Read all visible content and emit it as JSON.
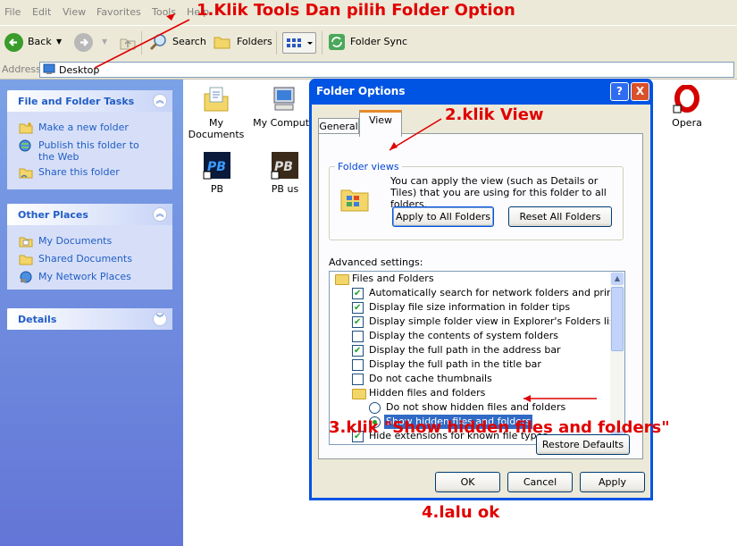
{
  "menu": [
    "File",
    "Edit",
    "View",
    "Favorites",
    "Tools",
    "Help"
  ],
  "toolbar": {
    "back": "Back",
    "search": "Search",
    "folders": "Folders",
    "folder_sync": "Folder Sync"
  },
  "address": {
    "label": "Address",
    "value": "Desktop"
  },
  "tasks_panel": {
    "title": "File and Folder Tasks",
    "links": [
      "Make a new folder",
      "Publish this folder to the Web",
      "Share this folder"
    ]
  },
  "places_panel": {
    "title": "Other Places",
    "links": [
      "My Documents",
      "Shared Documents",
      "My Network Places"
    ]
  },
  "details_panel": {
    "title": "Details"
  },
  "desktop_icons": [
    "My Documents",
    "My Compute",
    "PB",
    "PB us",
    "Opera"
  ],
  "dialog": {
    "title": "Folder Options",
    "help_btn": "?",
    "close_btn": "X",
    "tabs": [
      "General",
      "View"
    ],
    "folder_views": {
      "title": "Folder views",
      "text": "You can apply the view (such as Details or Tiles) that you are using for this folder to all folders.",
      "apply_btn": "Apply to All Folders",
      "reset_btn": "Reset All Folders"
    },
    "advanced_label": "Advanced settings:",
    "tree": [
      {
        "kind": "folder",
        "label": "Files and Folders"
      },
      {
        "kind": "check",
        "label": "Automatically search for network folders and printers",
        "checked": true
      },
      {
        "kind": "check",
        "label": "Display file size information in folder tips",
        "checked": true
      },
      {
        "kind": "check",
        "label": "Display simple folder view in Explorer's Folders list",
        "checked": true
      },
      {
        "kind": "check",
        "label": "Display the contents of system folders",
        "checked": false
      },
      {
        "kind": "check",
        "label": "Display the full path in the address bar",
        "checked": true
      },
      {
        "kind": "check",
        "label": "Display the full path in the title bar",
        "checked": false
      },
      {
        "kind": "check",
        "label": "Do not cache thumbnails",
        "checked": false
      },
      {
        "kind": "folder",
        "label": "Hidden files and folders"
      },
      {
        "kind": "radio",
        "label": "Do not show hidden files and folders",
        "checked": false
      },
      {
        "kind": "radio",
        "label": "Show hidden files and folders",
        "checked": true
      },
      {
        "kind": "check",
        "label": "Hide extensions for known file types",
        "checked": true
      }
    ],
    "restore_btn": "Restore Defaults",
    "ok_btn": "OK",
    "cancel_btn": "Cancel",
    "apply_btn": "Apply"
  },
  "annotations": {
    "step1": "1.Klik Tools Dan pilih Folder Option",
    "step2": "2.klik View",
    "step3": "3.klik \"Show hidden files and folders\"",
    "step4": "4.lalu ok"
  },
  "colors": {
    "annotation": "#e00000",
    "dialog_title": "#0054e3",
    "link": "#215dc6"
  }
}
